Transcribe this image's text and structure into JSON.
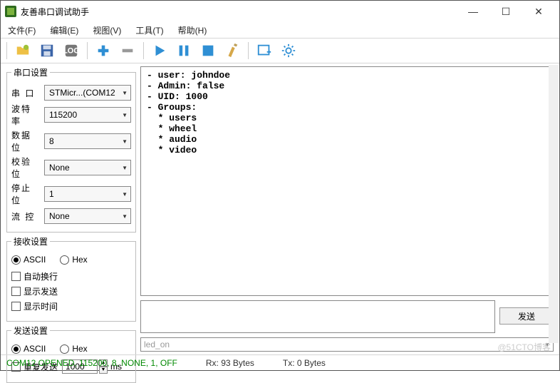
{
  "window": {
    "title": "友善串口调试助手"
  },
  "menu": {
    "file": "文件(F)",
    "edit": "编辑(E)",
    "view": "视图(V)",
    "tools": "工具(T)",
    "help": "帮助(H)"
  },
  "panels": {
    "serial": {
      "title": "串口设置",
      "port_label": "串  口",
      "port_value": "STMicr...(COM12",
      "baud_label": "波特率",
      "baud_value": "115200",
      "databits_label": "数据位",
      "databits_value": "8",
      "parity_label": "校验位",
      "parity_value": "None",
      "stopbits_label": "停止位",
      "stopbits_value": "1",
      "flow_label": "流  控",
      "flow_value": "None"
    },
    "recv": {
      "title": "接收设置",
      "ascii": "ASCII",
      "hex": "Hex",
      "autowrap": "自动换行",
      "showsend": "显示发送",
      "showtime": "显示时间"
    },
    "send": {
      "title": "发送设置",
      "ascii": "ASCII",
      "hex": "Hex",
      "repeat": "重复发送",
      "interval": "1000",
      "unit": "ms",
      "button": "发送",
      "history": "led_on"
    }
  },
  "output_text": "- user: johndoe\n- Admin: false\n- UID: 1000\n- Groups:\n  * users\n  * wheel\n  * audio\n  * video",
  "status": {
    "conn": "COM12 OPENED, 115200, 8, NONE, 1, OFF",
    "rx": "Rx: 93 Bytes",
    "tx": "Tx: 0 Bytes"
  },
  "watermark": "@51CTO博客"
}
